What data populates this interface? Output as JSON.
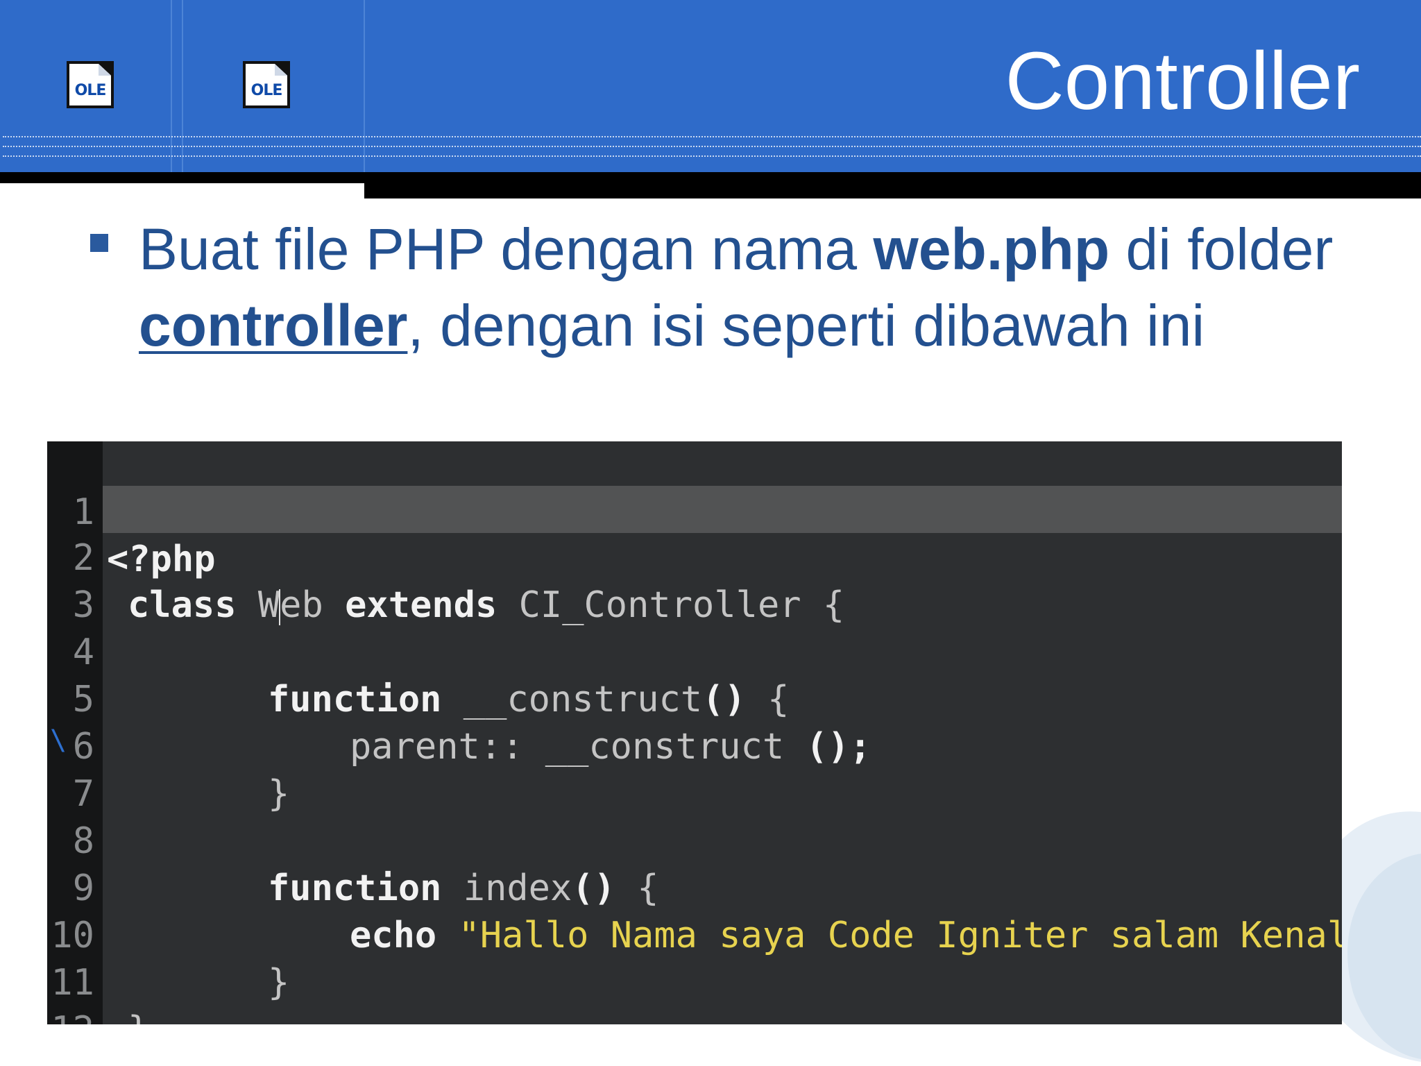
{
  "slide": {
    "title": "Controller",
    "ole_icons": [
      {
        "icon": "ole-object-icon",
        "label": "OLE"
      },
      {
        "icon": "ole-object-icon",
        "label": "OLE"
      }
    ],
    "bullet": {
      "part1": "Buat file PHP dengan nama ",
      "bold_file": "web.php",
      "part2": " di folder ",
      "bold_folder": "controller",
      "part3": ", dengan isi seperti dibawah ini"
    },
    "colors": {
      "header": "#2f6bc9",
      "title_text": "#ffffff",
      "bullet_text": "#23508f",
      "code_bg": "#2d2f31",
      "code_string": "#e7d34f"
    }
  },
  "code": {
    "line_numbers": [
      "1",
      "2",
      "3",
      "4",
      "5",
      "6",
      "7",
      "8",
      "9",
      "10",
      "11",
      "12"
    ],
    "lines": {
      "l1": "<?php",
      "l2_kw1": "class",
      "l2_name_a": "W",
      "l2_name_b": "eb",
      "l2_kw2": "extends",
      "l2_rest": "CI_Controller {",
      "l4_kw": "function",
      "l4_rest": "__construct",
      "l4_paren": "()",
      "l4_brace": "{",
      "l5_a": "parent::",
      "l5_b": "__construct",
      "l5_c": "();",
      "l6": "}",
      "l8_kw": "function",
      "l8_rest": "index",
      "l8_paren": "()",
      "l8_brace": "{",
      "l9_kw": "echo",
      "l9_str": "\"Hallo Nama saya Code Igniter salam Kenal\"",
      "l9_end": ";",
      "l10": "}",
      "l11": "}",
      "l12": "?>"
    }
  }
}
